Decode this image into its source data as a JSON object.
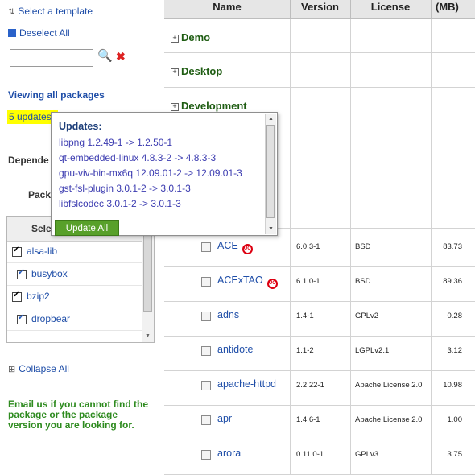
{
  "sidebar": {
    "select_template": "Select a template",
    "deselect_all": "Deselect All",
    "search": {
      "value": "",
      "placeholder": ""
    },
    "viewing": "Viewing all packages",
    "updates_link": "5 updates",
    "dependencies_label": "Depende",
    "packages_label": "Pack",
    "selected_header": "Sele",
    "selected_items": [
      {
        "label": "alsa-lib",
        "checked": true
      },
      {
        "label": "busybox",
        "checked": true
      },
      {
        "label": "bzip2",
        "checked": true
      },
      {
        "label": "dropbear",
        "checked": true
      }
    ],
    "collapse_all": "Collapse All",
    "email_note": "Email us if you cannot find the package or the package version you are looking for."
  },
  "table": {
    "headers": {
      "name": "Name",
      "version": "Version",
      "license": "License",
      "size": "(MB)"
    },
    "categories": [
      "Demo",
      "Desktop",
      "Development"
    ],
    "packages": [
      {
        "name": "ACE",
        "badge": true,
        "version": "6.0.3-1",
        "license": "BSD",
        "size": "83.73"
      },
      {
        "name": "ACExTAO",
        "badge": true,
        "version": "6.1.0-1",
        "license": "BSD",
        "size": "89.36"
      },
      {
        "name": "adns",
        "badge": false,
        "version": "1.4-1",
        "license": "GPLv2",
        "size": "0.28"
      },
      {
        "name": "antidote",
        "badge": false,
        "version": "1.1-2",
        "license": "LGPLv2.1",
        "size": "3.12"
      },
      {
        "name": "apache-httpd",
        "badge": false,
        "version": "2.2.22-1",
        "license": "Apache License 2.0",
        "size": "10.98"
      },
      {
        "name": "apr",
        "badge": false,
        "version": "1.4.6-1",
        "license": "Apache License 2.0",
        "size": "1.00"
      },
      {
        "name": "arora",
        "badge": false,
        "version": "0.11.0-1",
        "license": "GPLv3",
        "size": "3.75"
      }
    ]
  },
  "popup": {
    "title": "Updates:",
    "items": [
      "libpng 1.2.49-1 -> 1.2.50-1",
      "qt-embedded-linux 4.8.3-2 -> 4.8.3-3",
      "gpu-viv-bin-mx6q 12.09.01-2 -> 12.09.01-3",
      "gst-fsl-plugin 3.0.1-2 -> 3.0.1-3",
      "libfslcodec 3.0.1-2 -> 3.0.1-3"
    ],
    "button": "Update All"
  },
  "colors": {
    "link": "#1f4ea8",
    "category": "#1e5c12",
    "email": "#2e8b1f",
    "button": "#58a02a",
    "highlight": "#ffff00"
  }
}
